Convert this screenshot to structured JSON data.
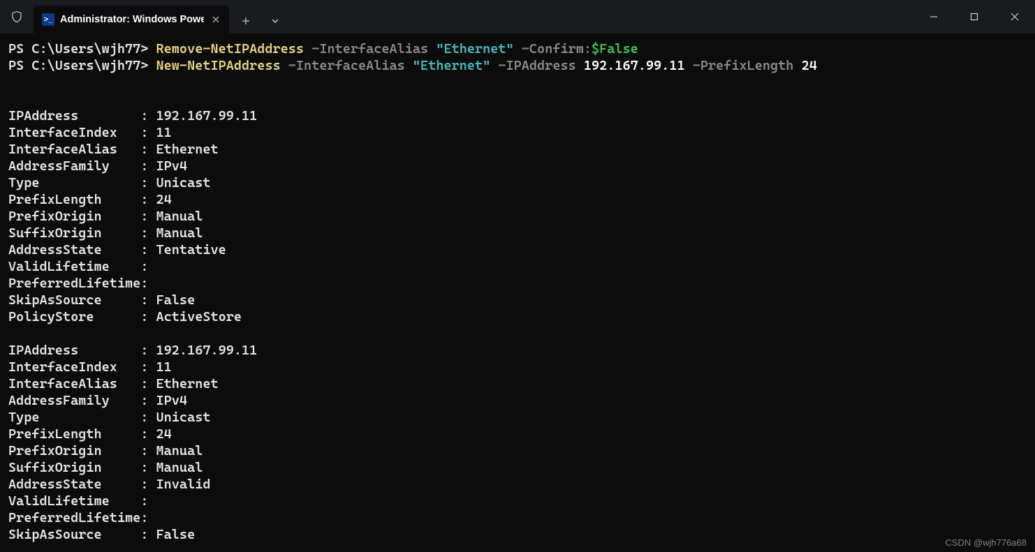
{
  "window": {
    "tab_title": "Administrator: Windows Powe",
    "watermark": "CSDN @wjh776a68"
  },
  "prompt": "PS C:\\Users\\wjh77>",
  "commands": [
    {
      "cmdlet": "Remove-NetIPAddress",
      "parts": [
        {
          "t": "param",
          "v": " -InterfaceAlias "
        },
        {
          "t": "str",
          "v": "\"Ethernet\""
        },
        {
          "t": "param",
          "v": " -Confirm:"
        },
        {
          "t": "var",
          "v": "$False"
        }
      ]
    },
    {
      "cmdlet": "New-NetIPAddress",
      "parts": [
        {
          "t": "param",
          "v": " -InterfaceAlias "
        },
        {
          "t": "str",
          "v": "\"Ethernet\""
        },
        {
          "t": "param",
          "v": " -IPAddress "
        },
        {
          "t": "num",
          "v": "192.167.99.11"
        },
        {
          "t": "param",
          "v": " -PrefixLength "
        },
        {
          "t": "num",
          "v": "24"
        }
      ]
    }
  ],
  "output_blocks": [
    [
      {
        "k": "IPAddress",
        "v": "192.167.99.11"
      },
      {
        "k": "InterfaceIndex",
        "v": "11"
      },
      {
        "k": "InterfaceAlias",
        "v": "Ethernet"
      },
      {
        "k": "AddressFamily",
        "v": "IPv4"
      },
      {
        "k": "Type",
        "v": "Unicast"
      },
      {
        "k": "PrefixLength",
        "v": "24"
      },
      {
        "k": "PrefixOrigin",
        "v": "Manual"
      },
      {
        "k": "SuffixOrigin",
        "v": "Manual"
      },
      {
        "k": "AddressState",
        "v": "Tentative"
      },
      {
        "k": "ValidLifetime",
        "v": ""
      },
      {
        "k": "PreferredLifetime",
        "v": ""
      },
      {
        "k": "SkipAsSource",
        "v": "False"
      },
      {
        "k": "PolicyStore",
        "v": "ActiveStore"
      }
    ],
    [
      {
        "k": "IPAddress",
        "v": "192.167.99.11"
      },
      {
        "k": "InterfaceIndex",
        "v": "11"
      },
      {
        "k": "InterfaceAlias",
        "v": "Ethernet"
      },
      {
        "k": "AddressFamily",
        "v": "IPv4"
      },
      {
        "k": "Type",
        "v": "Unicast"
      },
      {
        "k": "PrefixLength",
        "v": "24"
      },
      {
        "k": "PrefixOrigin",
        "v": "Manual"
      },
      {
        "k": "SuffixOrigin",
        "v": "Manual"
      },
      {
        "k": "AddressState",
        "v": "Invalid"
      },
      {
        "k": "ValidLifetime",
        "v": ""
      },
      {
        "k": "PreferredLifetime",
        "v": ""
      },
      {
        "k": "SkipAsSource",
        "v": "False"
      }
    ]
  ]
}
